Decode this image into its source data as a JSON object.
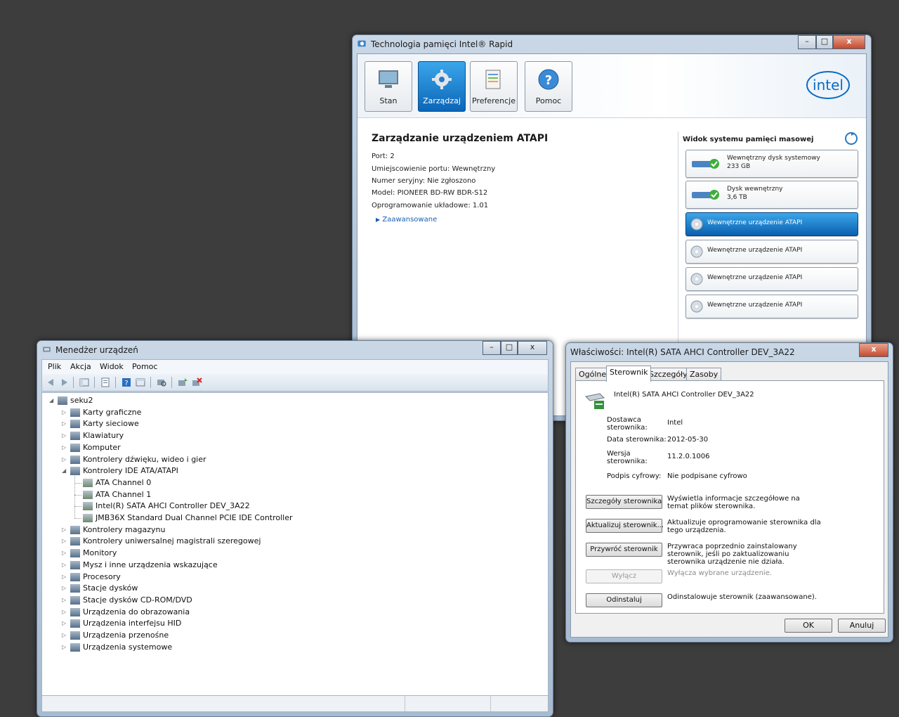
{
  "rst": {
    "title": "Technologia pamięci Intel® Rapid",
    "nav": [
      {
        "label": "Stan",
        "icon": "monitor-icon"
      },
      {
        "label": "Zarządzaj",
        "icon": "gear-icon"
      },
      {
        "label": "Preferencje",
        "icon": "preferences-icon"
      },
      {
        "label": "Pomoc",
        "icon": "help-icon"
      }
    ],
    "logo": "intel",
    "heading": "Zarządzanie urządzeniem ATAPI",
    "info": [
      "Port: 2",
      "Umiejscowienie portu: Wewnętrzny",
      "Numer seryjny: Nie zgłoszono",
      "Model: PIONEER BD-RW   BDR-S12",
      "Oprogramowanie układowe: 1.01"
    ],
    "advanced": "Zaawansowane",
    "side_title": "Widok systemu pamięci masowej",
    "devices": [
      {
        "name": "Wewnętrzny dysk systemowy",
        "size": "233 GB"
      },
      {
        "name": "Dysk wewnętrzny",
        "size": "3,6 TB"
      },
      {
        "name": "Wewnętrzne urządzenie ATAPI"
      },
      {
        "name": "Wewnętrzne urządzenie ATAPI"
      },
      {
        "name": "Wewnętrzne urządzenie ATAPI"
      },
      {
        "name": "Wewnętrzne urządzenie ATAPI"
      }
    ]
  },
  "dm": {
    "title": "Menedżer urządzeń",
    "menu": [
      "Plik",
      "Akcja",
      "Widok",
      "Pomoc"
    ],
    "root": "seku2",
    "tree": [
      "Karty graficzne",
      "Karty sieciowe",
      "Klawiatury",
      "Komputer",
      "Kontrolery dźwięku, wideo i gier",
      "Kontrolery IDE ATA/ATAPI",
      "ATA Channel 0",
      "ATA Channel 1",
      "Intel(R) SATA AHCI Controller DEV_3A22",
      "JMB36X Standard Dual Channel PCIE IDE Controller",
      "Kontrolery magazynu",
      "Kontrolery uniwersalnej magistrali szeregowej",
      "Monitory",
      "Mysz i inne urządzenia wskazujące",
      "Procesory",
      "Stacje dysków",
      "Stacje dysków CD-ROM/DVD",
      "Urządzenia do obrazowania",
      "Urządzenia interfejsu HID",
      "Urządzenia przenośne",
      "Urządzenia systemowe"
    ]
  },
  "props": {
    "title": "Właściwości: Intel(R) SATA AHCI Controller DEV_3A22",
    "tabs": [
      "Ogólne",
      "Sterownik",
      "Szczegóły",
      "Zasoby"
    ],
    "device_name": "Intel(R) SATA AHCI Controller DEV_3A22",
    "fields": [
      {
        "label": "Dostawca sterownika:",
        "value": "Intel"
      },
      {
        "label": "Data sterownika:",
        "value": "2012-05-30"
      },
      {
        "label": "Wersja sterownika:",
        "value": "11.2.0.1006"
      },
      {
        "label": "Podpis cyfrowy:",
        "value": "Nie podpisane cyfrowo"
      }
    ],
    "actions": [
      {
        "button": "Szczegóły sterownika",
        "desc": "Wyświetla informacje szczegółowe na temat plików sterownika."
      },
      {
        "button": "Aktualizuj sterownik...",
        "desc": "Aktualizuje oprogramowanie sterownika dla tego urządzenia."
      },
      {
        "button": "Przywróć sterownik",
        "desc": "Przywraca poprzednio zainstalowany sterownik, jeśli po zaktualizowaniu sterownika urządzenie nie działa."
      },
      {
        "button": "Wyłącz",
        "desc": "Wyłącza wybrane urządzenie."
      },
      {
        "button": "Odinstaluj",
        "desc": "Odinstalowuje sterownik (zaawansowane)."
      }
    ],
    "ok": "OK",
    "cancel": "Anuluj"
  },
  "colors": {
    "accent": "#0b66b9",
    "desktop": "#3d3d3d"
  }
}
